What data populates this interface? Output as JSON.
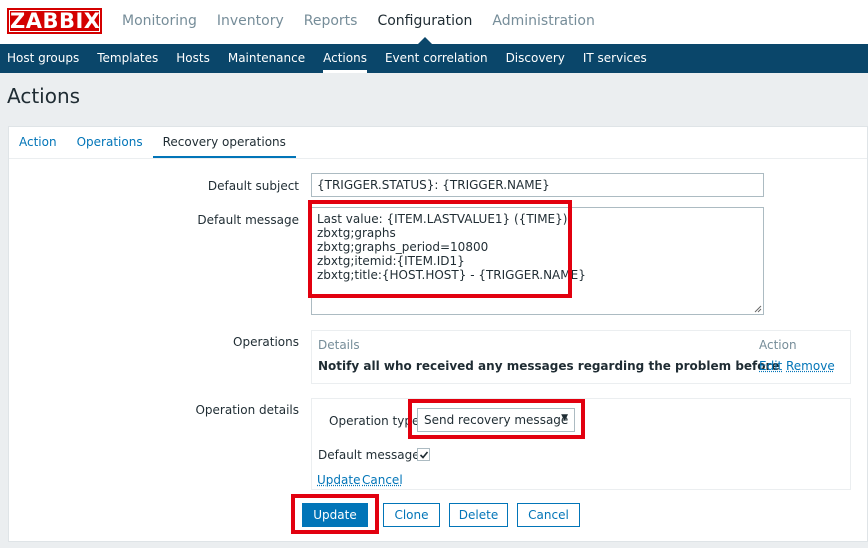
{
  "logo": {
    "text": "ZABBIX"
  },
  "topnav": [
    "Monitoring",
    "Inventory",
    "Reports",
    "Configuration",
    "Administration"
  ],
  "subnav": [
    "Host groups",
    "Templates",
    "Hosts",
    "Maintenance",
    "Actions",
    "Event correlation",
    "Discovery",
    "IT services"
  ],
  "page": {
    "title": "Actions"
  },
  "tabs": [
    "Action",
    "Operations",
    "Recovery operations"
  ],
  "form": {
    "default_subject_label": "Default subject",
    "default_subject_value": "{TRIGGER.STATUS}: {TRIGGER.NAME}",
    "default_message_label": "Default message",
    "default_message_lines": [
      "Last value: {ITEM.LASTVALUE1} ({TIME})",
      "zbxtg;graphs",
      "zbxtg;graphs_period=10800",
      "zbxtg;itemid:{ITEM.ID1}",
      "zbxtg;title:{HOST.HOST} - {TRIGGER.NAME}"
    ],
    "operations_label": "Operations",
    "operations_table": {
      "col_details": "Details",
      "col_action": "Action",
      "row_details": "Notify all who received any messages regarding the problem before",
      "row_edit": "Edit",
      "row_remove": "Remove"
    },
    "operation_details_label": "Operation details",
    "operation_type_label": "Operation type",
    "operation_type_value": "Send recovery message",
    "default_message_check_label": "Default message",
    "default_message_checked": true,
    "inner_update": "Update",
    "inner_cancel": "Cancel"
  },
  "buttons": {
    "update": "Update",
    "clone": "Clone",
    "delete": "Delete",
    "cancel": "Cancel"
  },
  "colors": {
    "brand": "#d40000",
    "nav_bg": "#0a466a",
    "link": "#0275b8",
    "highlight": "#e2000f"
  }
}
